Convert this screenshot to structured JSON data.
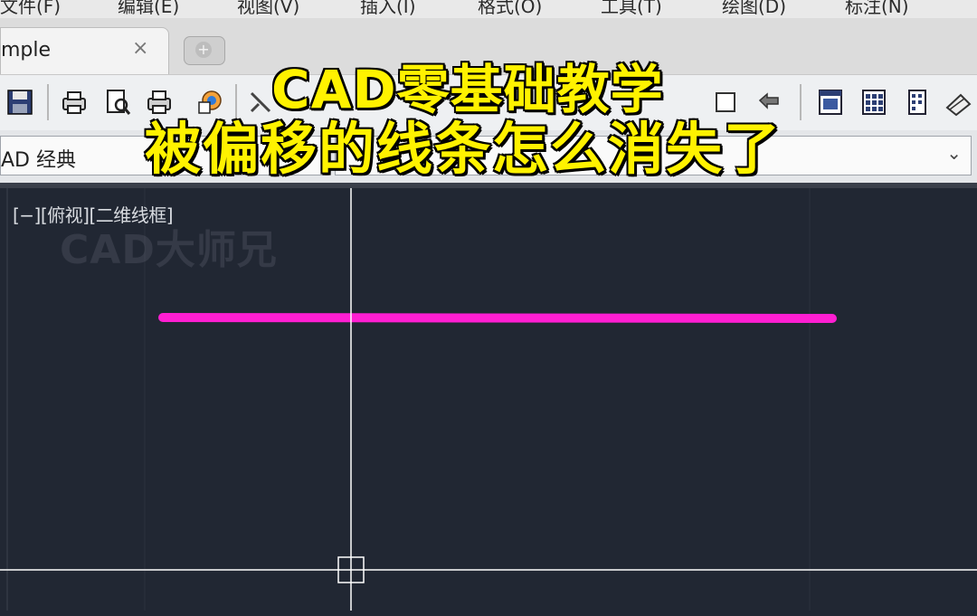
{
  "menu": {
    "items": [
      "文件(F)",
      "编辑(E)",
      "视图(V)",
      "插入(I)",
      "格式(O)",
      "工具(T)",
      "绘图(D)",
      "标注(N)"
    ]
  },
  "tabs": {
    "active_label": "mple",
    "close_glyph": "×",
    "new_glyph": "+"
  },
  "toolbar": {
    "icons": [
      "save-icon",
      "print-icon",
      "print-preview-icon",
      "plot-icon",
      "publish-icon",
      "match-properties-icon",
      "undo-icon",
      "properties-icon",
      "design-center-icon",
      "tool-palette-icon",
      "sheet-set-icon"
    ]
  },
  "workspace": {
    "selected": "AD 经典",
    "chevron": "⌄"
  },
  "viewport": {
    "label": "[−][俯视][二维线框]",
    "watermark": "CAD大师兄"
  },
  "overlay": {
    "title_line1": "CAD零基础教学",
    "title_line2": "被偏移的线条怎么消失了"
  },
  "colors": {
    "canvas_bg": "#212733",
    "polyline": "#ff1ed2",
    "crosshair": "#ffffff",
    "title_fill": "#fff200"
  }
}
